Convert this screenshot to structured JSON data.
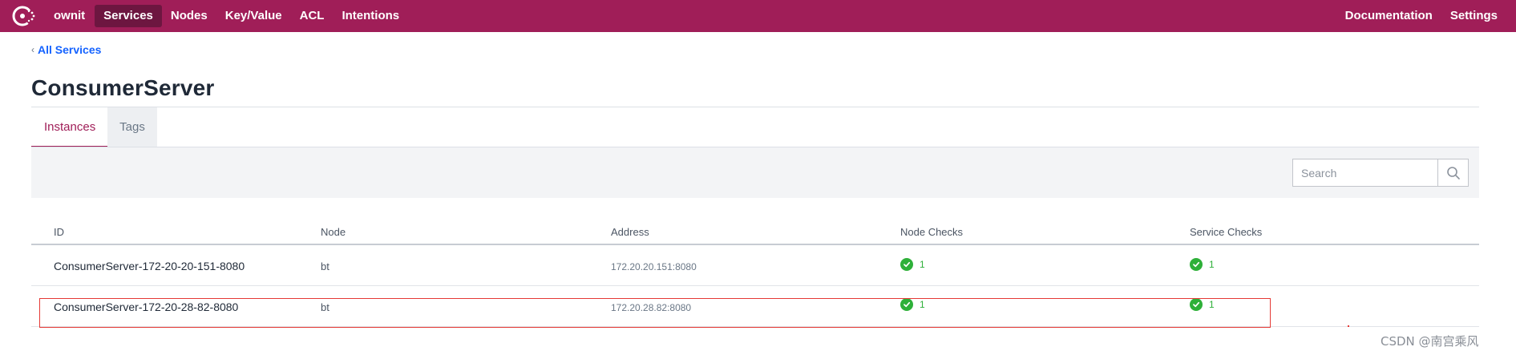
{
  "nav": {
    "datacenter": "ownit",
    "items": [
      {
        "label": "Services",
        "active": true
      },
      {
        "label": "Nodes",
        "active": false
      },
      {
        "label": "Key/Value",
        "active": false
      },
      {
        "label": "ACL",
        "active": false
      },
      {
        "label": "Intentions",
        "active": false
      }
    ],
    "right": [
      {
        "label": "Documentation"
      },
      {
        "label": "Settings"
      }
    ],
    "brand_color": "#a01e58",
    "logo_icon": "consul-logo-icon"
  },
  "breadcrumb": {
    "label": "All Services",
    "icon": "chevron-left-icon"
  },
  "page": {
    "title": "ConsumerServer"
  },
  "tabs": [
    {
      "label": "Instances",
      "active": true
    },
    {
      "label": "Tags",
      "active": false
    }
  ],
  "search": {
    "placeholder": "Search",
    "value": "",
    "icon": "search-icon"
  },
  "table": {
    "columns": [
      "ID",
      "Node",
      "Address",
      "Node Checks",
      "Service Checks"
    ],
    "rows": [
      {
        "id": "ConsumerServer-172-20-20-151-8080",
        "node": "bt",
        "address": "172.20.20.151:8080",
        "node_checks": "1",
        "service_checks": "1"
      },
      {
        "id": "ConsumerServer-172-20-28-82-8080",
        "node": "bt",
        "address": "172.20.28.82:8080",
        "node_checks": "1",
        "service_checks": "1"
      }
    ],
    "passing_color": "#2eb039"
  },
  "watermark": "CSDN @南宫乘风"
}
